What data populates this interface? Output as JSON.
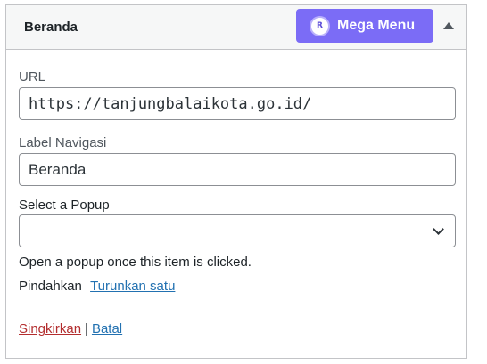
{
  "item": {
    "title": "Beranda",
    "mega_menu_label": "Mega Menu",
    "mega_logo_letter": "R"
  },
  "fields": {
    "url_label": "URL",
    "url_value": "https://tanjungbalaikota.go.id/",
    "nav_label": "Label Navigasi",
    "nav_value": "Beranda",
    "popup_label": "Select a Popup",
    "popup_value": "",
    "popup_help": "Open a popup once this item is clicked."
  },
  "move": {
    "label": "Pindahkan",
    "down_link": "Turunkan satu"
  },
  "actions": {
    "remove": "Singkirkan",
    "separator": "|",
    "cancel": "Batal"
  }
}
